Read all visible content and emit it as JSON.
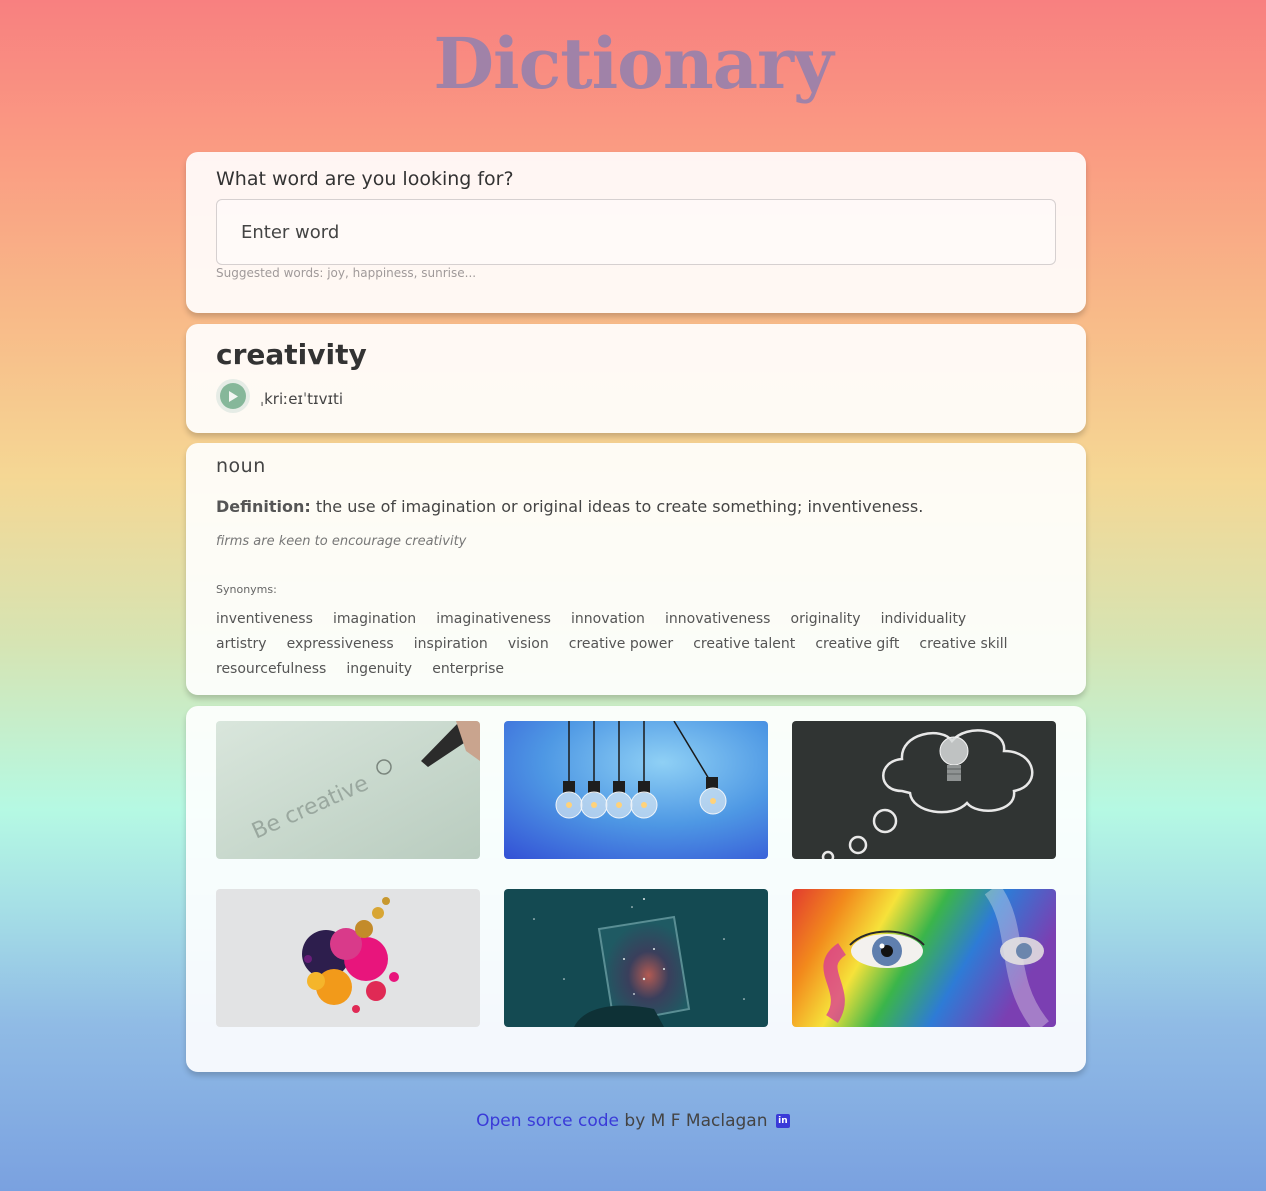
{
  "app": {
    "title": "Dictionary"
  },
  "search": {
    "question": "What word are you looking for?",
    "placeholder": "Enter word",
    "hint": "Suggested words: joy, happiness, sunrise..."
  },
  "entry": {
    "word": "creativity",
    "phonetic": "ˌkriːeɪˈtɪvɪti",
    "meaning": {
      "part_of_speech": "noun",
      "definition_label": "Definition:",
      "definition": "the use of imagination or original ideas to create something; inventiveness.",
      "example": "firms are keen to encourage creativity",
      "synonyms_label": "Synonyms:",
      "synonyms": [
        "inventiveness",
        "imagination",
        "imaginativeness",
        "innovation",
        "innovativeness",
        "originality",
        "individuality",
        "artistry",
        "expressiveness",
        "inspiration",
        "vision",
        "creative power",
        "creative talent",
        "creative gift",
        "creative skill",
        "resourcefulness",
        "ingenuity",
        "enterprise"
      ]
    }
  },
  "images": [
    {
      "name": "be-creative-pen-image"
    },
    {
      "name": "hanging-lightbulbs-image"
    },
    {
      "name": "chalk-thought-bubble-lightbulb-image"
    },
    {
      "name": "paint-splash-image"
    },
    {
      "name": "starry-jar-image"
    },
    {
      "name": "rainbow-face-paint-eye-image"
    }
  ],
  "footer": {
    "link_text": "Open sorce code",
    "by_text": " by M F Maclagan ",
    "icon": "linkedin-icon",
    "icon_text": "in"
  },
  "colors": {
    "title": "#a082a8",
    "play": "#86b79a",
    "link": "#3a3ad8"
  }
}
